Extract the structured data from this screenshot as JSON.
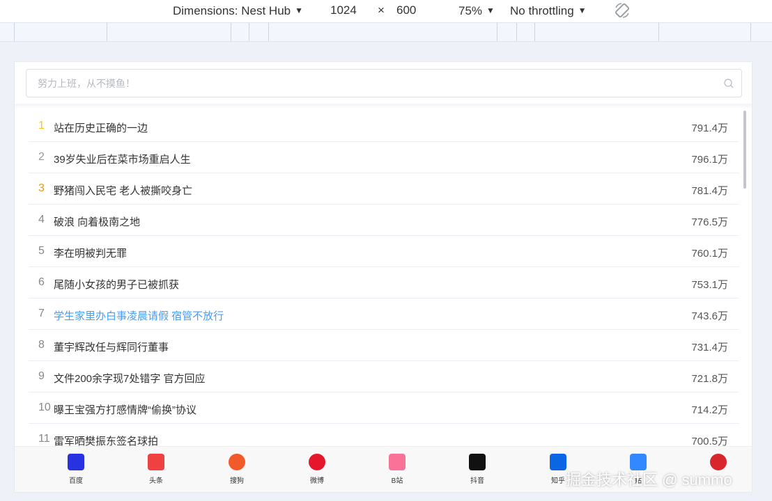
{
  "devtools": {
    "dimensions_label": "Dimensions: Nest Hub",
    "width": "1024",
    "times": "×",
    "height": "600",
    "zoom": "75%",
    "throttling": "No throttling"
  },
  "search": {
    "placeholder": "努力上班，从不摸鱼！"
  },
  "list": [
    {
      "rank": "1",
      "title": "站在历史正确的一边",
      "heat": "791.4万"
    },
    {
      "rank": "2",
      "title": "39岁失业后在菜市场重启人生",
      "heat": "796.1万"
    },
    {
      "rank": "3",
      "title": "野猪闯入民宅 老人被撕咬身亡",
      "heat": "781.4万"
    },
    {
      "rank": "4",
      "title": "破浪 向着极南之地",
      "heat": "776.5万"
    },
    {
      "rank": "5",
      "title": "李在明被判无罪",
      "heat": "760.1万"
    },
    {
      "rank": "6",
      "title": "尾随小女孩的男子已被抓获",
      "heat": "753.1万"
    },
    {
      "rank": "7",
      "title": "学生家里办白事凌晨请假 宿管不放行",
      "heat": "743.6万"
    },
    {
      "rank": "8",
      "title": "董宇辉改任与辉同行董事",
      "heat": "731.4万"
    },
    {
      "rank": "9",
      "title": "文件200余字现7处错字 官方回应",
      "heat": "721.8万"
    },
    {
      "rank": "10",
      "title": "曝王宝强方打感情牌“偷换”协议",
      "heat": "714.2万"
    },
    {
      "rank": "11",
      "title": "雷军晒樊振东签名球拍",
      "heat": "700.5万"
    }
  ],
  "nav": [
    {
      "label": "百度",
      "icon": "baidu-icon",
      "color": "#2932e1"
    },
    {
      "label": "头条",
      "icon": "toutiao-icon",
      "color": "#f04142"
    },
    {
      "label": "搜狗",
      "icon": "sogou-icon",
      "color": "#f25a29"
    },
    {
      "label": "微博",
      "icon": "weibo-icon",
      "color": "#e6162d"
    },
    {
      "label": "B站",
      "icon": "bilibili-icon",
      "color": "#fb7299"
    },
    {
      "label": "抖音",
      "icon": "douyin-icon",
      "color": "#111111"
    },
    {
      "label": "知乎",
      "icon": "zhihu-icon",
      "color": "#0a66e4"
    },
    {
      "label": "贴",
      "icon": "tieba-icon",
      "color": "#3388ff"
    },
    {
      "label": "",
      "icon": "other-icon",
      "color": "#d9262c"
    }
  ],
  "watermark": "掘金技术社区 @ summo"
}
